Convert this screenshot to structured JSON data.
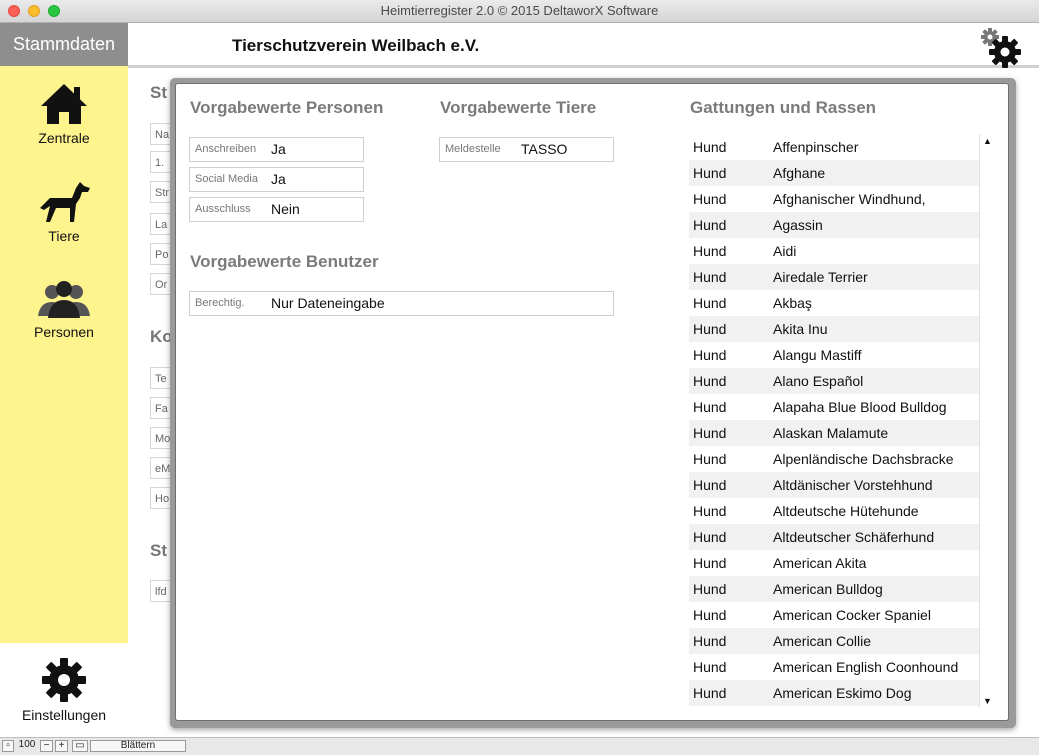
{
  "window": {
    "title": "Heimtierregister 2.0 © 2015 DeltaworX Software"
  },
  "sidebar": {
    "header": "Stammdaten",
    "items": [
      {
        "label": "Zentrale",
        "icon": "home-icon"
      },
      {
        "label": "Tiere",
        "icon": "dog-icon"
      },
      {
        "label": "Personen",
        "icon": "people-icon"
      }
    ],
    "settings": {
      "label": "Einstellungen",
      "icon": "gear-icon"
    }
  },
  "main": {
    "org_title": "Tierschutzverein Weilbach e.V.",
    "background": {
      "headings": [
        "St",
        "Ko",
        "St"
      ],
      "fields": [
        "Na",
        "1.",
        "Str",
        "La",
        "Po",
        "Or",
        "Te",
        "Fa",
        "Mo",
        "eM",
        "Ho",
        "lfd"
      ]
    }
  },
  "settings_panel": {
    "personen": {
      "title": "Vorgabewerte Personen",
      "fields": [
        {
          "label": "Anschreiben",
          "value": "Ja"
        },
        {
          "label": "Social Media",
          "value": "Ja"
        },
        {
          "label": "Ausschluss",
          "value": "Nein"
        }
      ]
    },
    "tiere": {
      "title": "Vorgabewerte Tiere",
      "fields": [
        {
          "label": "Meldestelle",
          "value": "TASSO"
        }
      ]
    },
    "benutzer": {
      "title": "Vorgabewerte Benutzer",
      "fields": [
        {
          "label": "Berechtig.",
          "value": "Nur Dateneingabe"
        }
      ]
    },
    "rassen": {
      "title": "Gattungen und Rassen",
      "rows": [
        [
          "Hund",
          "Affenpinscher"
        ],
        [
          "Hund",
          "Afghane"
        ],
        [
          "Hund",
          "Afghanischer Windhund,"
        ],
        [
          "Hund",
          "Agassin"
        ],
        [
          "Hund",
          "Aidi"
        ],
        [
          "Hund",
          "Airedale Terrier"
        ],
        [
          "Hund",
          "Akbaş"
        ],
        [
          "Hund",
          "Akita Inu"
        ],
        [
          "Hund",
          "Alangu Mastiff"
        ],
        [
          "Hund",
          "Alano Español"
        ],
        [
          "Hund",
          "Alapaha Blue Blood Bulldog"
        ],
        [
          "Hund",
          "Alaskan Malamute"
        ],
        [
          "Hund",
          "Alpenländische Dachsbracke"
        ],
        [
          "Hund",
          "Altdänischer Vorstehhund"
        ],
        [
          "Hund",
          "Altdeutsche Hütehunde"
        ],
        [
          "Hund",
          "Altdeutscher Schäferhund"
        ],
        [
          "Hund",
          "American Akita"
        ],
        [
          "Hund",
          "American Bulldog"
        ],
        [
          "Hund",
          "American Cocker Spaniel"
        ],
        [
          "Hund",
          "American Collie"
        ],
        [
          "Hund",
          "American English Coonhound"
        ],
        [
          "Hund",
          "American Eskimo Dog"
        ]
      ]
    }
  },
  "statusbar": {
    "zoom": "100",
    "mode": "Blättern"
  }
}
